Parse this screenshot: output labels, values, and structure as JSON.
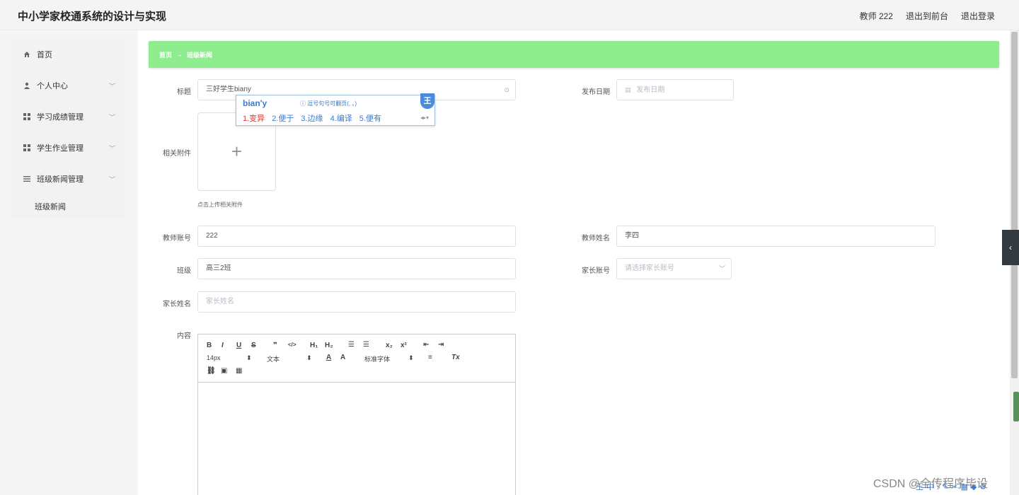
{
  "header": {
    "title": "中小学家校通系统的设计与实现",
    "user": "教师 222",
    "to_front": "退出到前台",
    "logout": "退出登录"
  },
  "sidebar": {
    "items": [
      {
        "label": "首页",
        "icon": "home-icon"
      },
      {
        "label": "个人中心",
        "icon": "user-icon"
      },
      {
        "label": "学习成绩管理",
        "icon": "grid-icon"
      },
      {
        "label": "学生作业管理",
        "icon": "grid-icon"
      },
      {
        "label": "班级新闻管理",
        "icon": "list-icon"
      }
    ],
    "sub_item": "班级新闻"
  },
  "breadcrumb": {
    "home": "首页",
    "arrow": "→",
    "current": "班级新闻"
  },
  "form": {
    "title_label": "标题",
    "title_value": "三好学生biany",
    "date_label": "发布日期",
    "date_placeholder": "发布日期",
    "attach_label": "相关附件",
    "upload_plus": "+",
    "attach_hint": "点击上传相关附件",
    "teacher_acct_label": "教师账号",
    "teacher_acct_value": "222",
    "teacher_name_label": "教师姓名",
    "teacher_name_value": "李四",
    "class_label": "班级",
    "class_value": "高三2班",
    "parent_acct_label": "家长账号",
    "parent_acct_placeholder": "请选择家长账号",
    "parent_name_label": "家长姓名",
    "parent_name_placeholder": "家长姓名",
    "content_label": "内容"
  },
  "editor": {
    "font_size": "14px",
    "text_type": "文本",
    "font_family": "标准字体"
  },
  "ime": {
    "pinyin": "bian'y",
    "tip": "ⓘ 逗号句号可翻页(, 。)",
    "candidates": [
      "1.变异",
      "2.便于",
      "3.边缘",
      "4.编译",
      "5.便有"
    ],
    "badge": "王"
  },
  "watermark": "CSDN @全传程序毕设"
}
